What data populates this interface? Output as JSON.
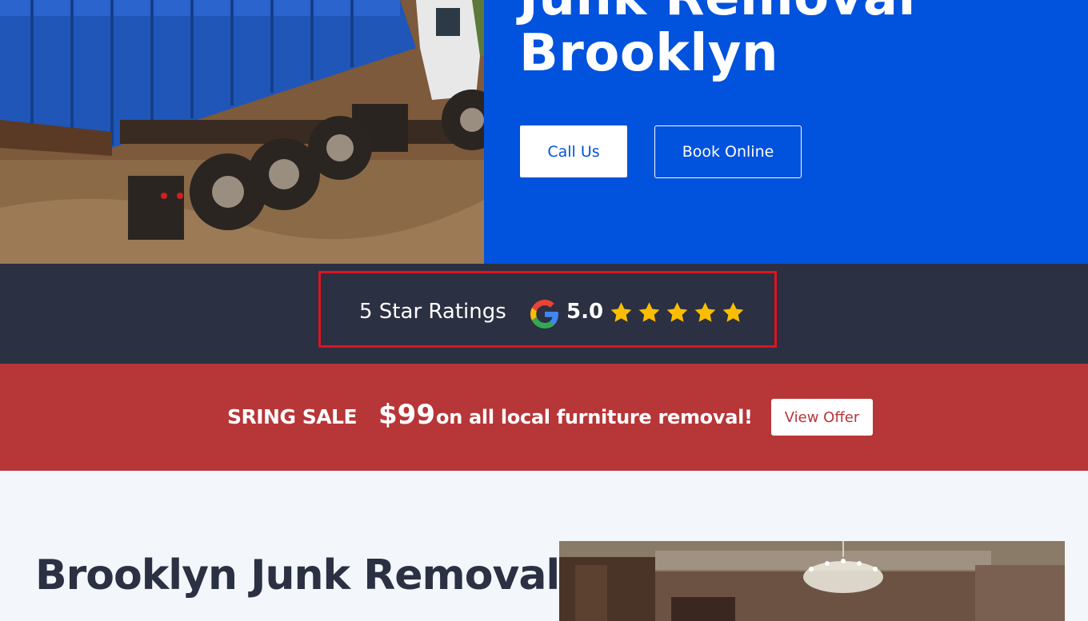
{
  "hero": {
    "title_line1": "Junk Removal",
    "title_line2": "Brooklyn",
    "call_label": "Call Us",
    "book_label": "Book Online",
    "photo_icon": "dumpster-truck-photo",
    "colors": {
      "panel": "#0152dc"
    }
  },
  "ratings": {
    "label": "5 Star Ratings",
    "score": "5.0",
    "stars": 5,
    "provider_icon": "google-icon",
    "colors": {
      "background": "#2b3042",
      "highlight_border": "#e0131f",
      "star": "#fbbc04"
    }
  },
  "sale": {
    "tag": "SRING SALE",
    "price": "$99",
    "text": "on all local furniture removal!",
    "offer_label": "View Offer",
    "colors": {
      "background": "#b73638"
    }
  },
  "content": {
    "title": "Brooklyn Junk Removal",
    "photo_icon": "room-chandelier-photo"
  }
}
